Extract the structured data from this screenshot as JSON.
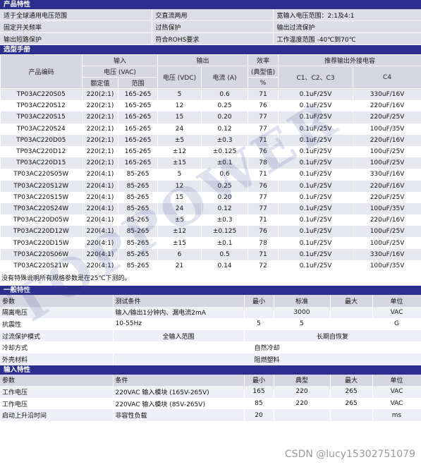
{
  "features": {
    "title": "产品特性",
    "rows": [
      [
        "适于全球通用电压范围",
        "交直流两用",
        "宽输入电压范围：2:1及4:1"
      ],
      [
        "固定开关频率",
        "过热保护",
        "输出过流保护"
      ],
      [
        "输出短路保护",
        "符合ROHS要求",
        "工作温度范围 -40℃到70℃"
      ]
    ]
  },
  "selection": {
    "title": "选型手册",
    "h_code": "产品编码",
    "h_input": "输入",
    "h_volt": "电压 (VAC)",
    "h_rated": "额定值",
    "h_range": "范围",
    "h_output": "输出",
    "h_vout": "电压 (VDC)",
    "h_iout": "电流 (A)",
    "h_eff": "效率",
    "h_eff2": "(典型值)",
    "h_pct": "%",
    "h_cap": "推荐输出外接电容",
    "h_c123": "C1、C2、C3",
    "h_c4": "C4",
    "rows": [
      [
        "TP03AC220S05",
        "220(2:1)",
        "165-265",
        "5",
        "0.6",
        "71",
        "0.1uF/25V",
        "330uF/16V"
      ],
      [
        "TP03AC220S12",
        "220(2:1)",
        "165-265",
        "12",
        "0.25",
        "76",
        "0.1uF/25V",
        "220uF/16V"
      ],
      [
        "TP03AC220S15",
        "220(2:1)",
        "165-265",
        "15",
        "0.20",
        "77",
        "0.1uF/25V",
        "220uF/25V"
      ],
      [
        "TP03AC220S24",
        "220(2:1)",
        "165-265",
        "24",
        "0.12",
        "77",
        "0.1uF/25V",
        "100uF/35V"
      ],
      [
        "TP03AC220D05",
        "220(2:1)",
        "165-265",
        "±5",
        "±0.3",
        "71",
        "0.1uF/25V",
        "220uF/16V"
      ],
      [
        "TP03AC220D12",
        "220(2:1)",
        "165-265",
        "±12",
        "±0.125",
        "76",
        "0.1uF/25V",
        "100uF/25V"
      ],
      [
        "TP03AC220D15",
        "220(2:1)",
        "165-265",
        "±15",
        "±0.1",
        "78",
        "0.1uF/25V",
        "100uF/25V"
      ],
      [
        "TP03AC220S05W",
        "220(4:1)",
        "85-265",
        "5",
        "0.6",
        "71",
        "0.1uF/25V",
        "330uF/16V"
      ],
      [
        "TP03AC220S12W",
        "220(4:1)",
        "85-265",
        "12",
        "0.25",
        "76",
        "0.1uF/25V",
        "220uF/16V"
      ],
      [
        "TP03AC220S15W",
        "220(4:1)",
        "85-265",
        "15",
        "0.20",
        "77",
        "0.1uF/25V",
        "220uF/25V"
      ],
      [
        "TP03AC220S24W",
        "220(4:1)",
        "85-265",
        "24",
        "0.12",
        "77",
        "0.1uF/25V",
        "100uF/35V"
      ],
      [
        "TP03AC220D05W",
        "220(4:1)",
        "85-265",
        "±5",
        "±0.3",
        "71",
        "0.1uF/25V",
        "220uF/16V"
      ],
      [
        "TP03AC220D12W",
        "220(4:1)",
        "85-265",
        "±12",
        "±0.125",
        "76",
        "0.1uF/25V",
        "100uF/25V"
      ],
      [
        "TP03AC220D15W",
        "220(4:1)",
        "85-265",
        "±15",
        "±0.1",
        "78",
        "0.1uF/25V",
        "100uF/25V"
      ],
      [
        "TP03AC220S06W",
        "220(4:1)",
        "85-265",
        "6",
        "0.5",
        "71",
        "0.1uF/25V",
        "330uF/16V"
      ],
      [
        "TP03AC220S21W",
        "220(4:1)",
        "85-265",
        "21",
        "0.14",
        "72",
        "0.1uF/25V",
        "100uF/35V"
      ]
    ],
    "note": "没有特殊说明所有规格参数是在25℃下测的。"
  },
  "general": {
    "title": "一般特性",
    "h": [
      "参数",
      "测试条件",
      "最小",
      "标准",
      "最大",
      "单位"
    ],
    "rows": [
      [
        "隔离电压",
        "输入/输出1分钟内、漏电流2mA",
        "",
        "3000",
        "",
        "VAC"
      ],
      [
        "抗震性",
        "10-55Hz",
        "5",
        "5",
        "",
        "G"
      ],
      [
        "过流保护模式",
        "全输入范围",
        "长期自恢复"
      ],
      [
        "冷却方式",
        "自然冷却"
      ],
      [
        "外壳材料",
        "阻燃塑料"
      ]
    ]
  },
  "input": {
    "title": "输入特性",
    "h": [
      "参数",
      "条件",
      "最小",
      "典型",
      "最大",
      "单位"
    ],
    "rows": [
      [
        "工作电压",
        "220VAC 输入模块 (165V-265V)",
        "165",
        "220",
        "265",
        "VAC"
      ],
      [
        "工作电压",
        "220VAC 输入模块 (85V-265V)",
        "85",
        "220",
        "265",
        "VAC"
      ],
      [
        "启动上升沿时间",
        "非容性负载",
        "20",
        "",
        "",
        "ms"
      ]
    ]
  },
  "watermark": "TOPPOWER",
  "csdn": "CSDN @lucy15302751079"
}
